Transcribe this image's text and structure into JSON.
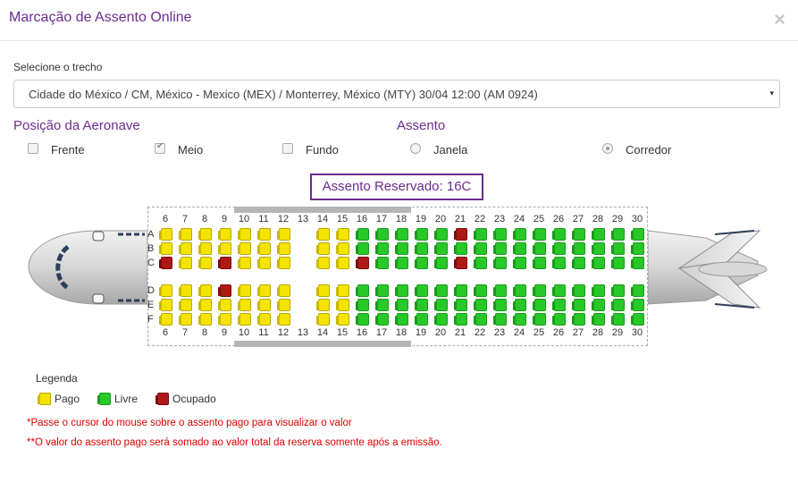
{
  "modal": {
    "title": "Marcação de Assento Online",
    "close_icon": "×"
  },
  "trecho": {
    "label": "Selecione o trecho",
    "selected": "Cidade do México / CM, México - Mexico (MEX) / Monterrey, México (MTY) 30/04 12:00 (AM 0924)",
    "arrow": "▾"
  },
  "posicao": {
    "title": "Posição da Aeronave",
    "options": [
      {
        "label": "Frente",
        "checked": false
      },
      {
        "label": "Meio",
        "checked": true
      },
      {
        "label": "Fundo",
        "checked": false
      }
    ]
  },
  "assento": {
    "title": "Assento",
    "options": [
      {
        "label": "Janela",
        "checked": false
      },
      {
        "label": "Corredor",
        "checked": true
      }
    ]
  },
  "reserved": "Assento Reservado: 16C",
  "seatmap": {
    "columns": [
      "6",
      "7",
      "8",
      "9",
      "10",
      "11",
      "12",
      "13",
      "14",
      "15",
      "16",
      "17",
      "18",
      "19",
      "20",
      "21",
      "22",
      "23",
      "24",
      "25",
      "26",
      "27",
      "28",
      "29",
      "30"
    ],
    "rows": [
      "A",
      "B",
      "C",
      "D",
      "E",
      "F"
    ],
    "seats": {
      "A": [
        "P",
        "P",
        "P",
        "P",
        "P",
        "P",
        "P",
        "-",
        "P",
        "P",
        "L",
        "L",
        "L",
        "L",
        "L",
        "O",
        "L",
        "L",
        "L",
        "L",
        "L",
        "L",
        "L",
        "L",
        "L"
      ],
      "B": [
        "P",
        "P",
        "P",
        "P",
        "P",
        "P",
        "P",
        "-",
        "P",
        "P",
        "L",
        "L",
        "L",
        "L",
        "L",
        "L",
        "L",
        "L",
        "L",
        "L",
        "L",
        "L",
        "L",
        "L",
        "L"
      ],
      "C": [
        "O",
        "P",
        "P",
        "O",
        "P",
        "P",
        "P",
        "-",
        "P",
        "P",
        "O",
        "L",
        "L",
        "L",
        "L",
        "O",
        "L",
        "L",
        "L",
        "L",
        "L",
        "L",
        "L",
        "L",
        "L"
      ],
      "D": [
        "P",
        "P",
        "P",
        "O",
        "P",
        "P",
        "P",
        "-",
        "P",
        "P",
        "L",
        "L",
        "L",
        "L",
        "L",
        "L",
        "L",
        "L",
        "L",
        "L",
        "L",
        "L",
        "L",
        "L",
        "L"
      ],
      "E": [
        "P",
        "P",
        "P",
        "P",
        "P",
        "P",
        "P",
        "-",
        "P",
        "P",
        "L",
        "L",
        "L",
        "L",
        "L",
        "L",
        "L",
        "L",
        "L",
        "L",
        "L",
        "L",
        "L",
        "L",
        "L"
      ],
      "F": [
        "P",
        "P",
        "P",
        "P",
        "P",
        "P",
        "P",
        "-",
        "P",
        "P",
        "L",
        "L",
        "L",
        "L",
        "L",
        "L",
        "L",
        "L",
        "L",
        "L",
        "L",
        "L",
        "L",
        "L",
        "L"
      ]
    }
  },
  "legend": {
    "title": "Legenda",
    "items": [
      {
        "label": "Pago",
        "color": "#f4e400"
      },
      {
        "label": "Livre",
        "color": "#28c828"
      },
      {
        "label": "Ocupado",
        "color": "#b01818"
      }
    ]
  },
  "notes": [
    "*Passe o cursor do mouse sobre o assento pago para visualizar o valor",
    "**O valor do assento pago será somado ao valor total da reserva somente após a emissão."
  ],
  "colors": {
    "accent": "#6b2c8f",
    "warning": "#e00000"
  }
}
